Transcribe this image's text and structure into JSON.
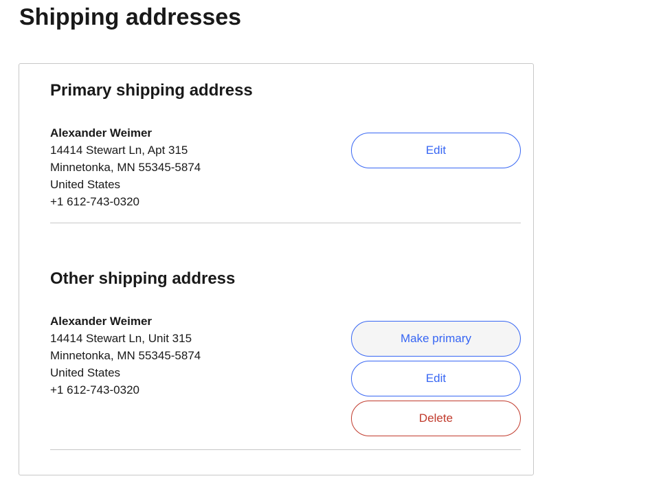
{
  "page": {
    "title": "Shipping addresses"
  },
  "primary": {
    "heading": "Primary shipping address",
    "name": "Alexander Weimer",
    "line1": "14414 Stewart Ln, Apt 315",
    "line2": "Minnetonka, MN 55345-5874",
    "country": "United States",
    "phone": "+1 612-743-0320",
    "edit_label": "Edit"
  },
  "other": {
    "heading": "Other shipping address",
    "name": "Alexander Weimer",
    "line1": "14414 Stewart Ln, Unit 315",
    "line2": "Minnetonka, MN 55345-5874",
    "country": "United States",
    "phone": "+1 612-743-0320",
    "make_primary_label": "Make primary",
    "edit_label": "Edit",
    "delete_label": "Delete"
  },
  "colors": {
    "accent": "#3665f3",
    "danger": "#c0392b",
    "border": "#c7c7c7",
    "text": "#191919"
  }
}
